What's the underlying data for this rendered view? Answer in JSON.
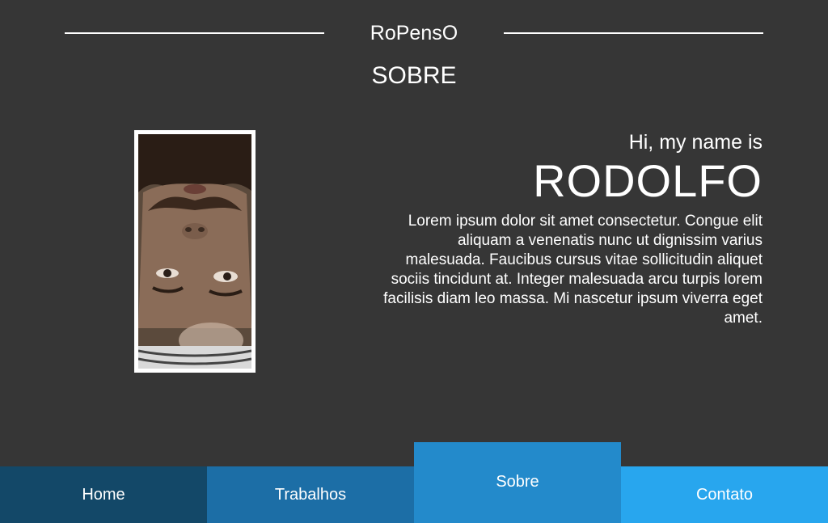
{
  "header": {
    "brand": "RoPensO",
    "title": "SOBRE"
  },
  "intro": {
    "greeting": "Hi, my name is",
    "name": "RODOLFO",
    "bio": "Lorem ipsum dolor sit amet consectetur. Congue elit aliquam a venenatis nunc ut dignissim varius malesuada. Faucibus cursus vitae sollicitudin aliquet sociis tincidunt at. Integer malesuada arcu turpis lorem facilisis diam leo massa. Mi nascetur ipsum viverra eget amet."
  },
  "nav": {
    "items": [
      {
        "label": "Home",
        "color": "#134868"
      },
      {
        "label": "Trabalhos",
        "color": "#1c6ea6"
      },
      {
        "label": "Sobre",
        "color": "#238acb",
        "active": true
      },
      {
        "label": "Contato",
        "color": "#28a6ee"
      }
    ]
  },
  "colors": {
    "background": "#363636",
    "text": "#ffffff",
    "photo_border": "#ffffff"
  }
}
